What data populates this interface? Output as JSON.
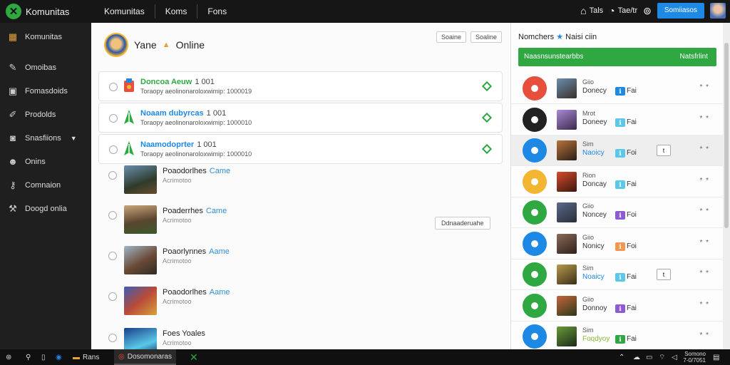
{
  "topbar": {
    "brand": "Komunitas",
    "tabs": [
      "Komunitas",
      "Koms",
      "Fons"
    ],
    "links": [
      {
        "label": "Tals",
        "icon": "home-icon"
      },
      {
        "label": "Tae/tr",
        "icon": "bell-icon"
      }
    ],
    "account_button": "Somiiasos"
  },
  "sidebar": {
    "items": [
      {
        "label": "Komunitas",
        "icon": "grid-icon"
      },
      {
        "label": "Omoibas",
        "icon": "pin-icon"
      },
      {
        "label": "Fomasdoids",
        "icon": "monitor-icon"
      },
      {
        "label": "Prodolds",
        "icon": "brush-icon"
      },
      {
        "label": "Snasfiions",
        "icon": "controller-icon",
        "has_caret": true
      },
      {
        "label": "Onins",
        "icon": "people-icon"
      },
      {
        "label": "Comnaion",
        "icon": "key-icon"
      },
      {
        "label": "Doogd onlia",
        "icon": "wrench-icon"
      }
    ]
  },
  "profile": {
    "name": "Yane",
    "status": "Online",
    "buttons": [
      "Soaine",
      "Soaline"
    ]
  },
  "cards": [
    {
      "name": "Doncoa Aeuw",
      "number": "1 001",
      "sub": "Toraopy aeolinonaroloxwimip: 1000019",
      "color": "#2fa842",
      "icon": "controller-icon"
    },
    {
      "name": "Noaam dubyrcas",
      "number": "1 001",
      "sub": "Toraopy aeolinonaroloxwimip: 1000010",
      "color": "#1e88e5",
      "icon": "leaf-icon"
    },
    {
      "name": "Naamodoprter",
      "number": "1 001",
      "sub": "Toraopy aeolinonaroloxwimip: 1000010",
      "color": "#1e88e5",
      "icon": "leaf-icon"
    }
  ],
  "games": [
    {
      "title": "Poaodorlhes",
      "tag": "Came",
      "sub": "Acrimotoo",
      "button": null
    },
    {
      "title": "Poaderrhes",
      "tag": "Came",
      "sub": "Acrimotoo",
      "button": "Ddnaaderuahe"
    },
    {
      "title": "Poaorlynnes",
      "tag": "Aame",
      "sub": "Acrimotoo",
      "button": null
    },
    {
      "title": "Poaodorlhes",
      "tag": "Aame",
      "sub": "Acrimotoo",
      "button": null
    },
    {
      "title": "Foes Yoales",
      "tag": "",
      "sub": "Acrimotoo",
      "button": null
    }
  ],
  "right_panel": {
    "title_pre": "Nomchers",
    "title_post": "Naisi ciin",
    "green_bar_left": "Naasnsunstearbbs",
    "green_bar_right": "Natsfrlint",
    "rows": [
      {
        "name": "Giio",
        "sub": "Donecy",
        "stat": "Fai",
        "badge_color": "#1e88e5",
        "circle": "#e84e3c",
        "button": false,
        "highlight": false
      },
      {
        "name": "Mrot",
        "sub": "Doneey",
        "stat": "Fai",
        "badge_color": "#5ac8e8",
        "circle": "#222222",
        "button": false,
        "highlight": false
      },
      {
        "name": "Sim",
        "sub": "Naoicy",
        "stat": "Foi",
        "badge_color": "#5ac8e8",
        "circle": "#1e88e5",
        "button": true,
        "highlight": true
      },
      {
        "name": "Rion",
        "sub": "Doncay",
        "stat": "Fai",
        "badge_color": "#5ac8e8",
        "circle": "#f2b632",
        "button": false,
        "highlight": false
      },
      {
        "name": "Giio",
        "sub": "Noncey",
        "stat": "Foi",
        "badge_color": "#8e5ad6",
        "circle": "#2fa842",
        "button": false,
        "highlight": false
      },
      {
        "name": "Giio",
        "sub": "Nonicy",
        "stat": "Foi",
        "badge_color": "#f29650",
        "circle": "#1e88e5",
        "button": false,
        "highlight": false
      },
      {
        "name": "Sim",
        "sub": "Noaicy",
        "stat": "Fai",
        "badge_color": "#5ac8e8",
        "circle": "#2fa842",
        "button": true,
        "highlight": false
      },
      {
        "name": "Giio",
        "sub": "Donnoy",
        "stat": "Fai",
        "badge_color": "#8e5ad6",
        "circle": "#2fa842",
        "button": false,
        "highlight": false
      },
      {
        "name": "Sim",
        "sub": "Foqdyoy",
        "stat": "Fai",
        "badge_color": "#2fa842",
        "circle": "#1e88e5",
        "button": false,
        "highlight": false
      }
    ],
    "stars": "* *",
    "small_button": "t"
  },
  "taskbar": {
    "apps": [
      "Rans",
      "Dosomonaras"
    ],
    "clock": [
      "Somono",
      "7-0/7051"
    ]
  }
}
